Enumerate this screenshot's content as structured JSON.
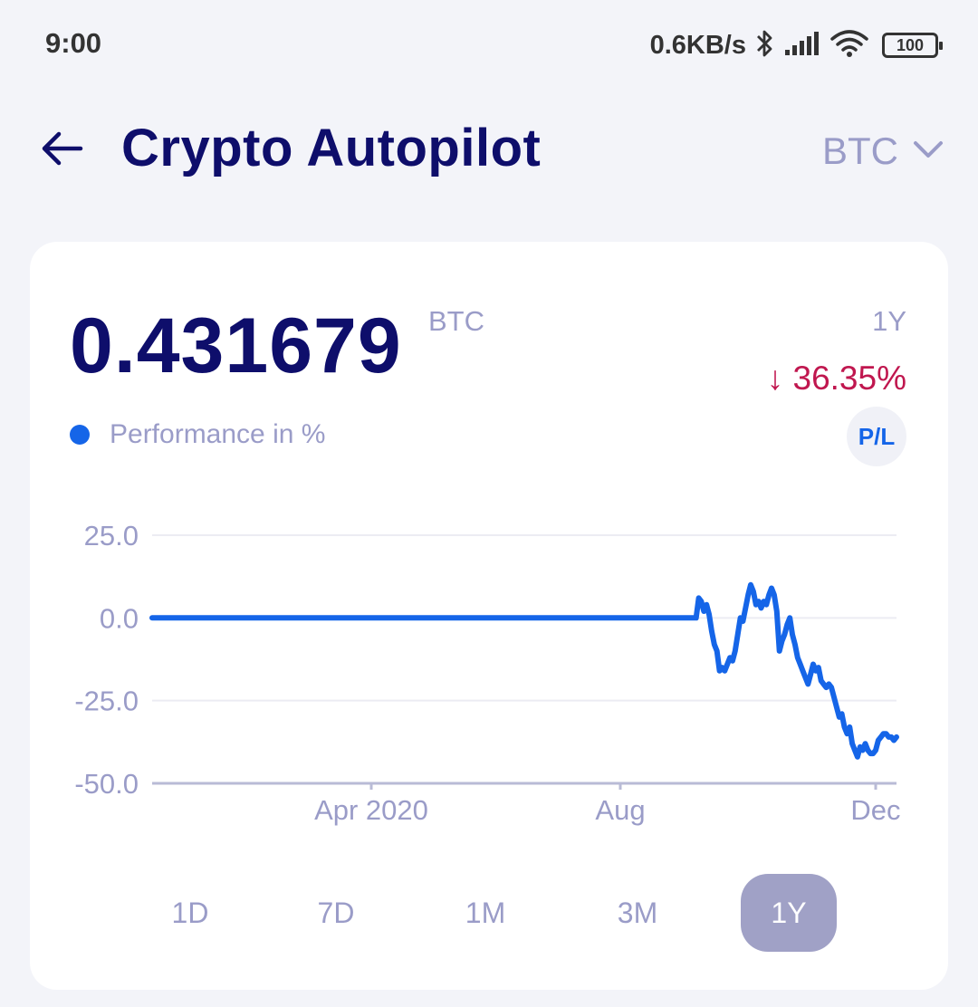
{
  "status_bar": {
    "time": "9:00",
    "net_speed": "0.6KB/s",
    "battery": "100",
    "icons": [
      "bluetooth-icon",
      "signal-icon",
      "wifi-icon",
      "battery-icon"
    ]
  },
  "header": {
    "title": "Crypto Autopilot",
    "currency": "BTC",
    "icons": [
      "back-arrow-icon",
      "chevron-down-icon"
    ]
  },
  "summary": {
    "balance": "0.431679",
    "unit": "BTC",
    "period": "1Y",
    "change": "↓ 36.35%",
    "legend": "Performance in %",
    "pl_button": "P/L"
  },
  "colors": {
    "accent": "#1565e8",
    "title": "#0e0e6b",
    "muted": "#9a9cc8",
    "negative": "#c0174f",
    "active_range": "#a0a1c6"
  },
  "chart_data": {
    "type": "line",
    "ylim": [
      -50,
      25
    ],
    "y_ticks": [
      "25.0",
      "0.0",
      "-25.0",
      "-50.0"
    ],
    "x_ticks": [
      "Apr 2020",
      "Aug",
      "Dec"
    ],
    "grid": true,
    "series": [
      {
        "values": [
          0,
          0,
          0,
          0,
          0,
          0,
          0,
          0,
          0,
          0,
          0,
          0,
          0,
          0,
          0,
          0,
          0,
          0,
          0,
          0,
          0,
          0,
          0,
          0,
          0,
          0,
          0,
          0,
          0,
          0,
          0,
          0,
          0,
          0,
          0,
          0,
          0,
          0,
          0,
          0,
          0,
          0,
          0,
          0,
          0,
          0,
          0,
          0,
          0,
          0,
          0,
          0,
          0,
          0,
          0,
          0,
          0,
          0,
          0,
          0,
          0,
          0,
          0,
          0,
          0,
          0,
          0,
          0,
          0,
          0,
          0,
          0,
          0,
          0,
          0,
          0,
          0,
          0,
          0,
          0,
          0,
          0,
          0,
          0,
          0,
          0,
          0,
          0,
          0,
          0,
          0,
          0,
          0,
          0,
          0,
          0,
          0,
          0,
          0,
          0,
          0,
          0,
          0,
          0,
          0,
          0,
          0,
          0,
          0,
          0,
          0,
          0,
          0,
          0,
          0,
          0,
          0,
          0,
          0,
          0,
          0,
          0,
          0,
          0,
          0,
          0,
          0,
          0,
          0,
          0,
          0,
          0,
          0,
          0,
          0,
          0,
          0,
          0,
          0,
          0,
          0,
          0,
          0,
          0,
          0,
          0,
          0,
          0,
          0,
          0,
          0,
          0,
          0,
          0,
          0,
          0,
          0,
          0,
          0,
          0,
          0,
          0,
          0,
          0,
          0,
          0,
          0,
          0,
          0,
          0,
          0,
          0,
          0,
          0,
          0,
          0,
          0,
          0,
          0,
          0,
          0,
          0,
          0,
          0,
          0,
          0,
          0,
          0,
          0,
          0,
          0,
          0,
          0,
          0,
          0,
          0,
          0,
          0,
          0,
          0,
          0,
          0,
          0,
          0,
          0,
          0,
          0,
          0,
          0,
          0,
          6,
          5,
          2,
          4,
          1,
          -4,
          -8,
          -10,
          -16,
          -15,
          -16,
          -14,
          -12,
          -13,
          -10,
          -5,
          0,
          -1,
          3,
          7,
          10,
          8,
          4,
          5,
          3,
          5,
          4,
          7,
          9,
          7,
          2,
          -10,
          -7,
          -5,
          -2,
          0,
          -5,
          -8,
          -12,
          -14,
          -16,
          -18,
          -20,
          -17,
          -14,
          -16,
          -15,
          -19,
          -20,
          -21,
          -20,
          -21,
          -24,
          -27,
          -30,
          -29,
          -33,
          -35,
          -33,
          -38,
          -40,
          -42,
          -39,
          -40,
          -38,
          -40,
          -41,
          -41,
          -40,
          -37,
          -36,
          -35,
          -35,
          -36,
          -36,
          -37,
          -36
        ]
      }
    ]
  },
  "ranges": {
    "items": [
      "1D",
      "7D",
      "1M",
      "3M",
      "1Y"
    ],
    "active": "1Y"
  }
}
